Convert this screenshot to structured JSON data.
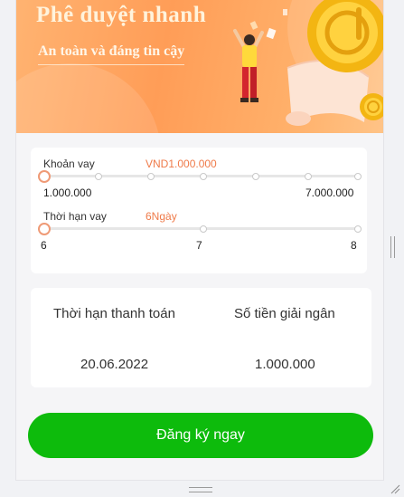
{
  "banner": {
    "title": "Phê duyệt nhanh",
    "subtitle": "An toàn và đáng tin cậy"
  },
  "loan": {
    "amount_label": "Khoản vay",
    "amount_value": "VND1.000.000",
    "amount_min": "1.000.000",
    "amount_max": "7.000.000",
    "amount_position": 0,
    "term_label": "Thời hạn vay",
    "term_value": "6Ngày",
    "term_ticks": [
      "6",
      "7",
      "8"
    ],
    "term_position": 0
  },
  "summary": {
    "due_date_label": "Thời hạn thanh toán",
    "due_date_value": "20.06.2022",
    "disbursement_label": "Số tiền giải ngân",
    "disbursement_value": "1.000.000"
  },
  "cta": {
    "label": "Đăng ký ngay"
  },
  "colors": {
    "accent": "#ef7a49",
    "button": "#0dbb0c",
    "banner": "#ff9d57"
  },
  "icons": [
    "gold-coin-icon",
    "person-celebrating-icon",
    "scroll-icon",
    "resize-grip-icon"
  ]
}
